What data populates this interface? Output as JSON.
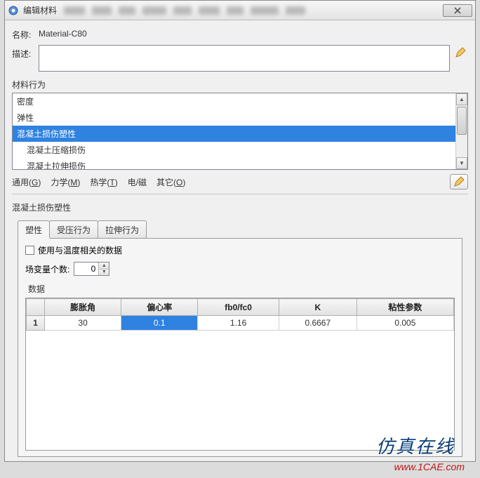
{
  "window": {
    "title": "编辑材料"
  },
  "name": {
    "label": "名称:",
    "value": "Material-C80"
  },
  "desc": {
    "label": "描述:",
    "value": ""
  },
  "behavior": {
    "label": "材料行为",
    "items": [
      {
        "label": "密度",
        "indent": false,
        "selected": false
      },
      {
        "label": "弹性",
        "indent": false,
        "selected": false
      },
      {
        "label": "混凝土损伤塑性",
        "indent": false,
        "selected": true
      },
      {
        "label": "混凝土压缩损伤",
        "indent": true,
        "selected": false
      },
      {
        "label": "混凝土拉伸损伤",
        "indent": true,
        "selected": false
      }
    ]
  },
  "menus": {
    "general_pre": "通用(",
    "general_u": "G",
    "general_post": ")",
    "mech_pre": "力学(",
    "mech_u": "M",
    "mech_post": ")",
    "therm_pre": "热学(",
    "therm_u": "T",
    "therm_post": ")",
    "elec": "电/磁",
    "other_pre": "其它(",
    "other_u": "O",
    "other_post": ")"
  },
  "cdpp": {
    "title": "混凝土损伤塑性",
    "tabs": [
      {
        "label": "塑性",
        "active": true
      },
      {
        "label": "受压行为",
        "active": false
      },
      {
        "label": "拉伸行为",
        "active": false
      }
    ],
    "temp_checkbox": "使用与温度相关的数据",
    "fieldvars_label": "场变量个数:",
    "fieldvars_value": "0",
    "data_label": "数据",
    "headers": [
      "膨胀角",
      "偏心率",
      "fb0/fc0",
      "K",
      "粘性参数"
    ],
    "rows": [
      {
        "num": "1",
        "cells": [
          "30",
          "0.1",
          "1.16",
          "0.6667",
          "0.005"
        ],
        "selected_col": 1
      }
    ]
  },
  "watermark": {
    "brand": "仿真在线",
    "url": "www.1CAE.com",
    "mid": ""
  }
}
